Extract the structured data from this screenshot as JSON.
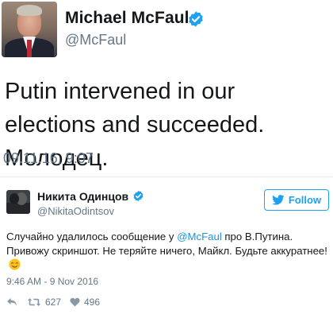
{
  "main_tweet": {
    "author_name": "Michael McFaul",
    "author_handle": "@McFaul",
    "text": "Putin intervened in our elections and succeeded. Молодец.",
    "date": "09.11.16, 9:07"
  },
  "embedded_tweet": {
    "author_name": "Никита Одинцов",
    "author_handle": "@NikitaOdintsov",
    "follow_label": "Follow",
    "text_part1": "Случайно удалилось сообщение у ",
    "mention": "@McFaul",
    "text_part2": " про В.Путина. Привожу скриншот. Не теряйте ничего, Майкл. Будьте аккуратнее!",
    "date": "9:46 AM - 9 Nov 2016",
    "retweet_count": "627",
    "like_count": "496"
  },
  "colors": {
    "brand_blue": "#1da1f2",
    "secondary_text": "#657786",
    "mention": "#1b95e0"
  },
  "icons": {
    "verified": "verified-badge-icon",
    "bird": "twitter-bird-icon",
    "reply": "reply-icon",
    "retweet": "retweet-icon",
    "like": "heart-icon",
    "emoji": "smiling-face-emoji"
  }
}
